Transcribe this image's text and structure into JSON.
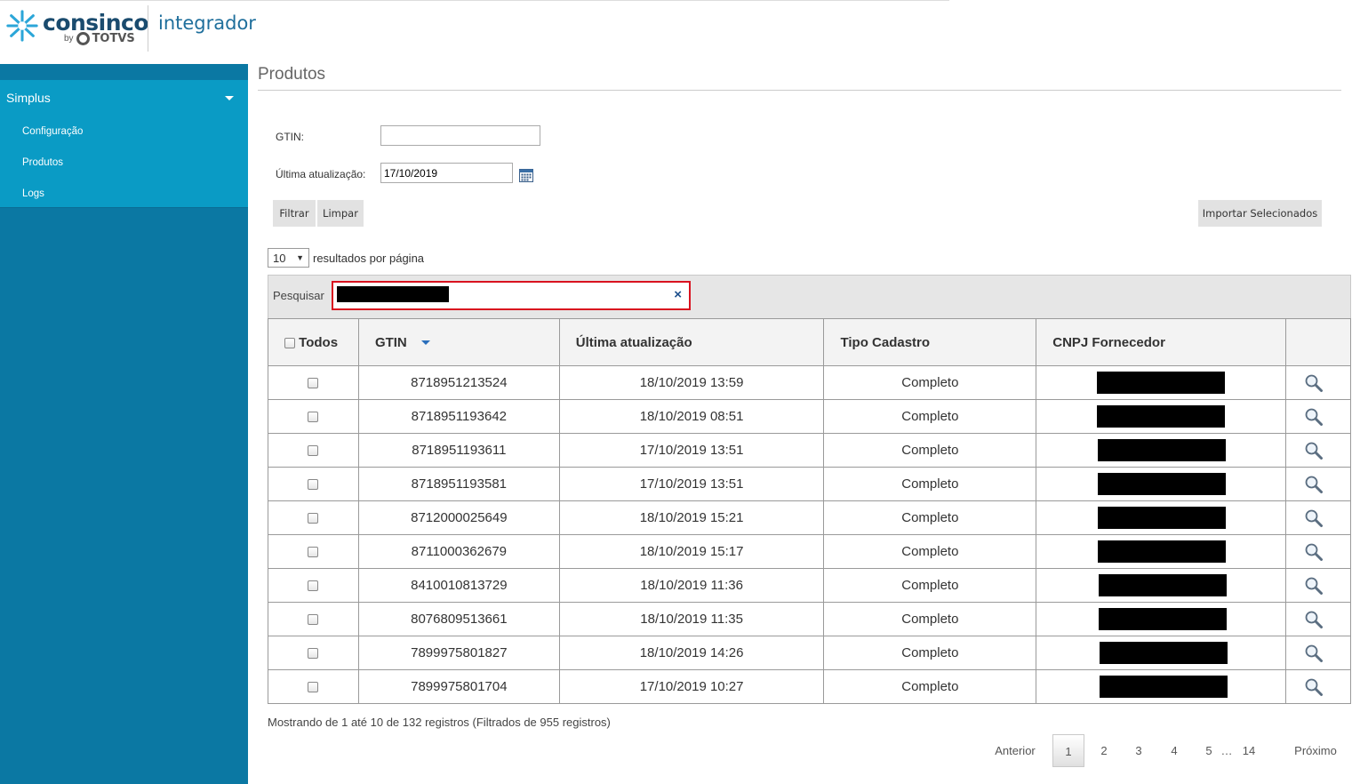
{
  "header": {
    "brand": "consinco",
    "by": "by",
    "brand_parent": "TOTVS",
    "product": "integrador"
  },
  "sidebar": {
    "group": "Simplus",
    "items": [
      {
        "label": "Configuração"
      },
      {
        "label": "Produtos"
      },
      {
        "label": "Logs"
      }
    ]
  },
  "page": {
    "title": "Produtos"
  },
  "filters": {
    "gtin_label": "GTIN:",
    "gtin_value": "",
    "date_label": "Última atualização:",
    "date_value": "17/10/2019",
    "filter_btn": "Filtrar",
    "clear_btn": "Limpar",
    "import_btn": "Importar Selecionados"
  },
  "table_controls": {
    "page_size": "10",
    "page_size_label": "resultados por página",
    "search_label": "Pesquisar",
    "clear_search": "×"
  },
  "table": {
    "headers": {
      "select_all": "Todos",
      "gtin": "GTIN",
      "updated": "Última atualização",
      "type": "Tipo Cadastro",
      "supplier": "CNPJ Fornecedor"
    },
    "rows": [
      {
        "gtin": "8718951213524",
        "updated": "18/10/2019 13:59",
        "type": "Completo"
      },
      {
        "gtin": "8718951193642",
        "updated": "18/10/2019 08:51",
        "type": "Completo"
      },
      {
        "gtin": "8718951193611",
        "updated": "17/10/2019 13:51",
        "type": "Completo"
      },
      {
        "gtin": "8718951193581",
        "updated": "17/10/2019 13:51",
        "type": "Completo"
      },
      {
        "gtin": "8712000025649",
        "updated": "18/10/2019 15:21",
        "type": "Completo"
      },
      {
        "gtin": "8711000362679",
        "updated": "18/10/2019 15:17",
        "type": "Completo"
      },
      {
        "gtin": "8410010813729",
        "updated": "18/10/2019 11:36",
        "type": "Completo"
      },
      {
        "gtin": "8076809513661",
        "updated": "18/10/2019 11:35",
        "type": "Completo"
      },
      {
        "gtin": "7899975801827",
        "updated": "18/10/2019 14:26",
        "type": "Completo"
      },
      {
        "gtin": "7899975801704",
        "updated": "17/10/2019 10:27",
        "type": "Completo"
      }
    ]
  },
  "footer": {
    "info": "Mostrando de 1 até 10 de 132 registros (Filtrados de 955 registros)"
  },
  "pagination": {
    "prev": "Anterior",
    "pages": [
      "1",
      "2",
      "3",
      "4",
      "5"
    ],
    "ellipsis": "…",
    "last": "14",
    "next": "Próximo",
    "current": "1"
  },
  "colors": {
    "sidebar": "#0b78a3",
    "sidebar_menu": "#0a9bc5",
    "highlight": "#d9121f"
  }
}
